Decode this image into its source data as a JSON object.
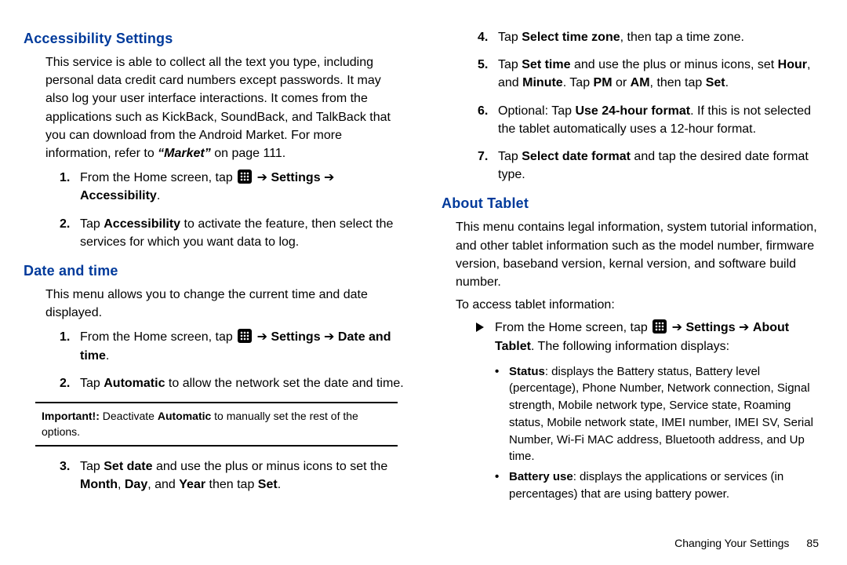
{
  "left": {
    "h_accessibility": "Accessibility Settings",
    "p_accessibility": "This service is able to collect all the text you type, including personal data credit card numbers except passwords. It may also log your user interface interactions. It comes from the applications such as KickBack, SoundBack, and TalkBack that you can download from the Android Market. For more information, refer to ",
    "p_accessibility_ref": "“Market”",
    "p_accessibility_ref_tail": "  on page 111.",
    "acc_step1_a": "From the Home screen, tap ",
    "acc_step1_b": " ➔ ",
    "acc_step1_settings": "Settings",
    "acc_step1_arrow2": " ➔ ",
    "acc_step1_acc": "Accessibility",
    "acc_step1_tail": ".",
    "acc_step2_a": "Tap ",
    "acc_step2_b": "Accessibility",
    "acc_step2_c": " to activate the feature, then select the services for which you want data to log.",
    "h_datetime": "Date and time",
    "p_datetime": "This menu allows you to change the current time and date displayed.",
    "dt_step1_a": "From the Home screen, tap ",
    "dt_step1_arrow1": "  ➔ ",
    "dt_step1_settings": "Settings",
    "dt_step1_arrow2": " ➔ ",
    "dt_step1_dt": "Date and time",
    "dt_step1_tail": ".",
    "dt_step2_a": "Tap ",
    "dt_step2_b": "Automatic",
    "dt_step2_c": " to allow the network set the date and time.",
    "note_label": "Important!:",
    "note_a": " Deactivate ",
    "note_b": "Automatic",
    "note_c": " to manually set the rest of the options.",
    "dt_step3_a": "Tap ",
    "dt_step3_b": "Set date",
    "dt_step3_c": " and use the plus or minus icons to set the ",
    "dt_step3_month": "Month",
    "dt_step3_comma1": ", ",
    "dt_step3_day": "Day",
    "dt_step3_comma2": ", and ",
    "dt_step3_year": "Year",
    "dt_step3_then": " then tap ",
    "dt_step3_set": "Set",
    "dt_step3_tail": "."
  },
  "right": {
    "dt_step4_a": "Tap ",
    "dt_step4_b": "Select time zone",
    "dt_step4_c": ", then tap a time zone.",
    "dt_step5_a": "Tap ",
    "dt_step5_b": "Set time",
    "dt_step5_c": " and use the plus or minus icons, set ",
    "dt_step5_hour": "Hour",
    "dt_step5_d": ", and ",
    "dt_step5_min": "Minute",
    "dt_step5_e": ". Tap ",
    "dt_step5_pm": "PM",
    "dt_step5_f": " or ",
    "dt_step5_am": "AM",
    "dt_step5_g": ", then tap ",
    "dt_step5_set": "Set",
    "dt_step5_tail": ".",
    "dt_step6_a": "Optional: Tap ",
    "dt_step6_b": "Use 24-hour format",
    "dt_step6_c": ". If this is not selected the tablet automatically uses a 12-hour format.",
    "dt_step7_a": "Tap ",
    "dt_step7_b": "Select date format",
    "dt_step7_c": " and tap the desired date format type.",
    "h_about": "About Tablet",
    "p_about": "This menu contains legal information, system tutorial information, and other tablet information such as the model number, firmware version, baseband version, kernal version, and software build number.",
    "p_about2": "To access tablet information:",
    "ab_step_a": "From the Home screen, tap ",
    "ab_step_arrow1": " ➔ ",
    "ab_step_settings": "Settings",
    "ab_step_arrow2": " ➔ ",
    "ab_step_about": "About Tablet",
    "ab_step_c": ". The following information displays:",
    "bullet1_a": "Status",
    "bullet1_b": ": displays the Battery status, Battery level (percentage), Phone Number, Network connection, Signal strength, Mobile network type, Service state, Roaming status, Mobile network state, IMEI number, IMEI SV, Serial Number, Wi-Fi MAC address, Bluetooth address, and Up time.",
    "bullet2_a": "Battery use",
    "bullet2_b": ": displays the applications or services (in percentages) that are using battery power."
  },
  "footer": {
    "chapter": "Changing Your Settings",
    "page": "85"
  }
}
